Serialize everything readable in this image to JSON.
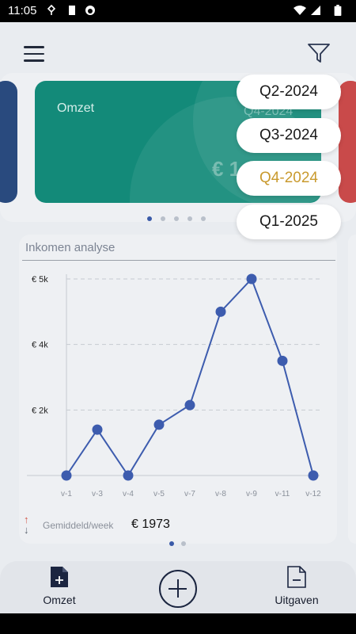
{
  "status_bar": {
    "time": "11:05"
  },
  "header": {
    "menu_icon": "hamburger-icon",
    "filter_icon": "filter-funnel-icon"
  },
  "summary_card": {
    "title": "Omzet",
    "quarter": "Q4-2024",
    "amount": "€ 1"
  },
  "quarter_menu": {
    "options": [
      "Q2-2024",
      "Q3-2024",
      "Q4-2024",
      "Q1-2025"
    ],
    "selected": "Q4-2024"
  },
  "income_chart": {
    "title": "Inkomen analyse",
    "average_label": "Gemiddeld/week",
    "average_value": "€ 1973"
  },
  "chart_data": {
    "type": "line",
    "title": "Inkomen analyse",
    "categories": [
      "v-1",
      "v-3",
      "v-4",
      "v-5",
      "v-7",
      "v-8",
      "v-9",
      "v-11",
      "v-12"
    ],
    "values": [
      0,
      1400,
      0,
      1550,
      2150,
      5000,
      6000,
      3500,
      0
    ],
    "y_ticks": [
      2000,
      4000,
      6000
    ],
    "y_tick_labels": [
      "€ 2k",
      "€ 4k",
      "€ 5k"
    ],
    "ylim": [
      0,
      6000
    ],
    "color": "#3d5cae",
    "grid": "dashed-horizontal"
  },
  "bottom_nav": {
    "left_label": "Omzet",
    "right_label": "Uitgaven",
    "left_icon": "document-plus-icon",
    "center_icon": "plus-circle-icon",
    "right_icon": "document-minus-icon"
  }
}
